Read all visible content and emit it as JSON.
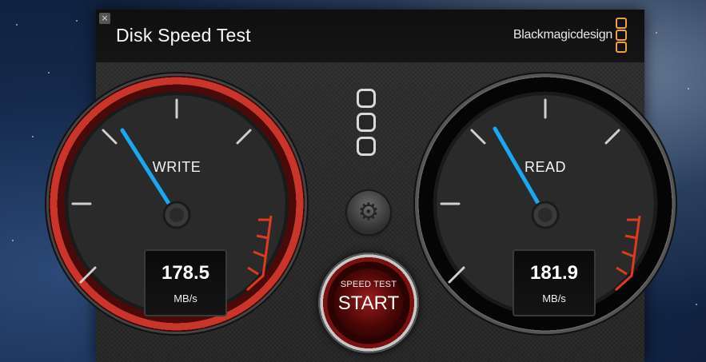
{
  "window": {
    "title": "Disk Speed Test",
    "close_label": "×",
    "brand": "Blackmagicdesign"
  },
  "gauges": {
    "write": {
      "label": "WRITE",
      "value": "178.5",
      "unit": "MB/s"
    },
    "read": {
      "label": "READ",
      "value": "181.9",
      "unit": "MB/s"
    }
  },
  "start_button": {
    "top_label": "SPEED TEST",
    "main_label": "START"
  },
  "colors": {
    "needle": "#1ba8f0",
    "redzone": "#e03a1e",
    "brand_logo": "#f0a23a"
  },
  "icons": {
    "settings": "gear-icon",
    "close": "close-icon",
    "brand": "blackmagic-logo-icon"
  }
}
